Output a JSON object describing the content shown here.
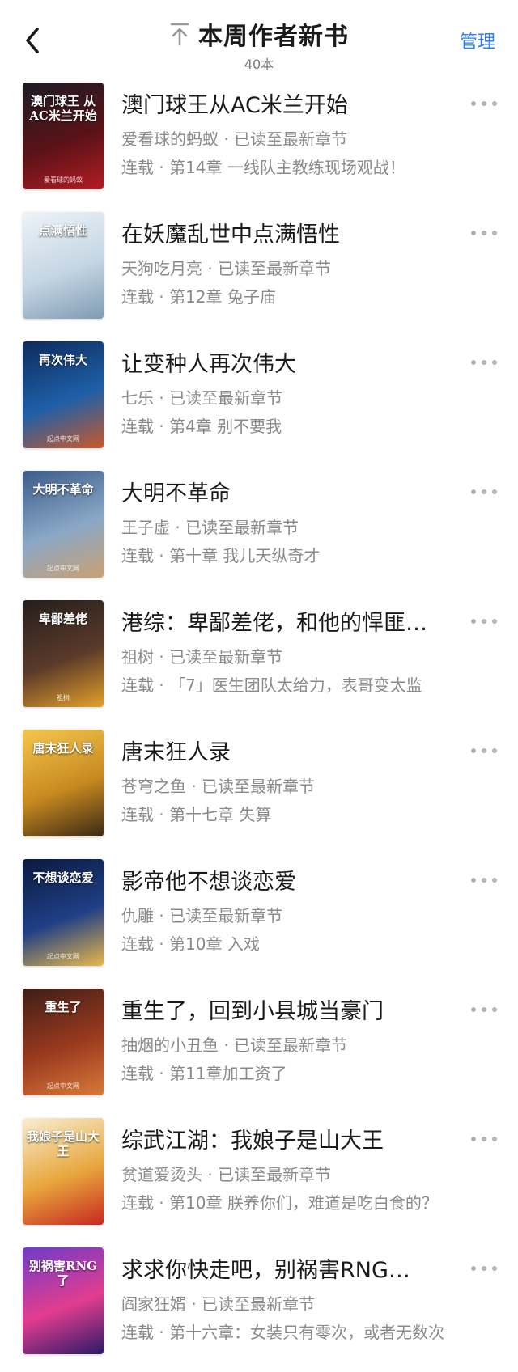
{
  "header": {
    "title": "本周作者新书",
    "count": "40本",
    "manage_label": "管理",
    "accent_color": "#2e7cf6"
  },
  "books": [
    {
      "title": "澳门球王从AC米兰开始",
      "author": "爱看球的蚂蚁",
      "read_status": "已读至最新章节",
      "status": "连载",
      "chapter": "第14章 一线队主教练现场观战！",
      "cover_title": "澳门球王 从AC米兰开始",
      "cover_author": "爱看球的蚂蚁",
      "cover_colors": [
        "#1b1b24",
        "#5a1218",
        "#b31d23"
      ]
    },
    {
      "title": "在妖魔乱世中点满悟性",
      "author": "天狗吃月亮",
      "read_status": "已读至最新章节",
      "status": "连载",
      "chapter": "第12章 兔子庙",
      "cover_title": "点满悟性",
      "cover_author": "",
      "cover_colors": [
        "#eef3f7",
        "#c5d6e4",
        "#7f9bb3"
      ]
    },
    {
      "title": "让变种人再次伟大",
      "author": "七乐",
      "read_status": "已读至最新章节",
      "status": "连载",
      "chapter": "第4章 别不要我",
      "cover_title": "再次伟大",
      "cover_author": "起点中文网",
      "cover_colors": [
        "#0d2b5c",
        "#1f5fa8",
        "#c75a2b"
      ]
    },
    {
      "title": "大明不革命",
      "author": "王子虚",
      "read_status": "已读至最新章节",
      "status": "连载",
      "chapter": "第十章 我儿天纵奇才",
      "cover_title": "大明不革命",
      "cover_author": "起点中文网",
      "cover_colors": [
        "#3b5c8a",
        "#8aa7c6",
        "#c9a173"
      ]
    },
    {
      "title": "港综：卑鄙差佬，和他的悍匪…",
      "author": "祖树",
      "read_status": "已读至最新章节",
      "status": "连载",
      "chapter": "「7」医生团队太给力，表哥变太监",
      "cover_title": "卑鄙差佬",
      "cover_author": "祖树",
      "cover_colors": [
        "#241f1d",
        "#5b3a2a",
        "#e3a02a"
      ]
    },
    {
      "title": "唐末狂人录",
      "author": "苍穹之鱼",
      "read_status": "已读至最新章节",
      "status": "连载",
      "chapter": "第十七章 失算",
      "cover_title": "唐末狂人录",
      "cover_author": "",
      "cover_colors": [
        "#f4c64e",
        "#c8891f",
        "#3a2a14"
      ]
    },
    {
      "title": "影帝他不想谈恋爱",
      "author": "仇雕",
      "read_status": "已读至最新章节",
      "status": "连载",
      "chapter": "第10章 入戏",
      "cover_title": "不想谈恋爱",
      "cover_author": "起点中文网",
      "cover_colors": [
        "#0b1a3d",
        "#1f3f86",
        "#e8b84a"
      ]
    },
    {
      "title": "重生了，回到小县城当豪门",
      "author": "抽烟的小丑鱼",
      "read_status": "已读至最新章节",
      "status": "连载",
      "chapter": "第11章加工资了",
      "cover_title": "重生了",
      "cover_author": "起点中文网",
      "cover_colors": [
        "#3d1e17",
        "#9c3a1f",
        "#d77a3a"
      ]
    },
    {
      "title": "综武江湖：我娘子是山大王",
      "author": "贫道爱烫头",
      "read_status": "已读至最新章节",
      "status": "连载",
      "chapter": "第10章 朕养你们，难道是吃白食的？",
      "cover_title": "我娘子是山大王",
      "cover_author": "",
      "cover_colors": [
        "#f7eed3",
        "#e8a63d",
        "#c7281f"
      ]
    },
    {
      "title": "求求你快走吧，别祸害RNG了！",
      "author": "阎家狂婿",
      "read_status": "已读至最新章节",
      "status": "连载",
      "chapter": "第十六章：女装只有零次，或者无数次",
      "cover_title": "别祸害RNG了",
      "cover_author": "",
      "cover_colors": [
        "#6e3cc9",
        "#e23d8f",
        "#2c1a66"
      ]
    }
  ]
}
